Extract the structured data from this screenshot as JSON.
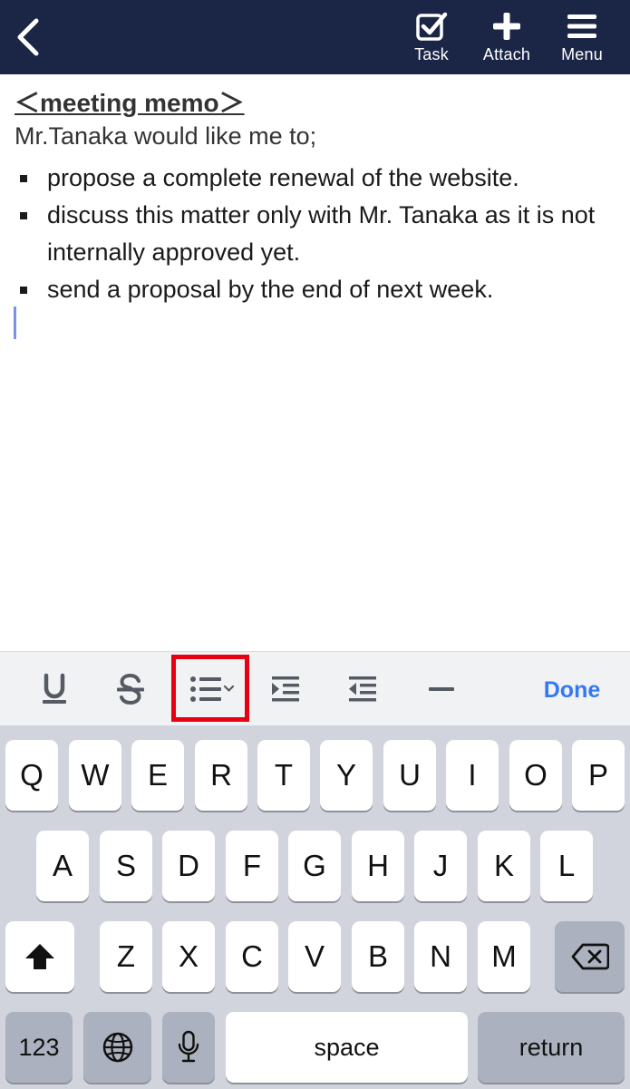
{
  "topbar": {
    "task_label": "Task",
    "attach_label": "Attach",
    "menu_label": "Menu"
  },
  "memo": {
    "title": "＜meeting memo＞",
    "intro": "Mr.Tanaka would like me to;",
    "bullets": [
      "propose a complete renewal of the website.",
      "discuss this matter only with Mr. Tanaka as it is not internally approved yet.",
      "send a proposal by the end of next week."
    ]
  },
  "format_toolbar": {
    "done_label": "Done",
    "accent_color": "#3478f6",
    "highlight_color": "#e60012"
  },
  "keyboard": {
    "row1": [
      "Q",
      "W",
      "E",
      "R",
      "T",
      "Y",
      "U",
      "I",
      "O",
      "P"
    ],
    "row2": [
      "A",
      "S",
      "D",
      "F",
      "G",
      "H",
      "J",
      "K",
      "L"
    ],
    "row3": [
      "Z",
      "X",
      "C",
      "V",
      "B",
      "N",
      "M"
    ],
    "numbers_label": "123",
    "space_label": "space",
    "return_label": "return"
  },
  "colors": {
    "topbar_bg": "#1b2546",
    "keyboard_bg": "#d1d4dc"
  }
}
